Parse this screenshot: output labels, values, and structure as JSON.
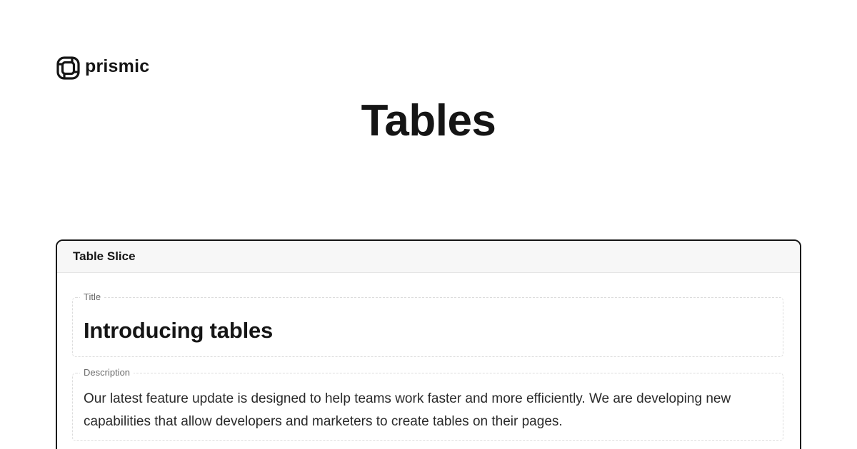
{
  "brand": {
    "logo_icon": "prismic-logo-icon",
    "name": "prismic"
  },
  "hero": {
    "title": "Tables"
  },
  "slice": {
    "header": "Table Slice",
    "fields": {
      "title": {
        "label": "Title",
        "value": "Introducing tables"
      },
      "description": {
        "label": "Description",
        "value": "Our latest feature update is designed to help teams work faster and more efficiently. We are developing new capabilities that allow developers and marketers to create tables on their pages."
      }
    }
  },
  "colors": {
    "text": "#151515",
    "card_border": "#151515",
    "header_bg": "#f7f7f7",
    "dashed_border": "#dcdcdc",
    "label": "#6a6a6a"
  }
}
